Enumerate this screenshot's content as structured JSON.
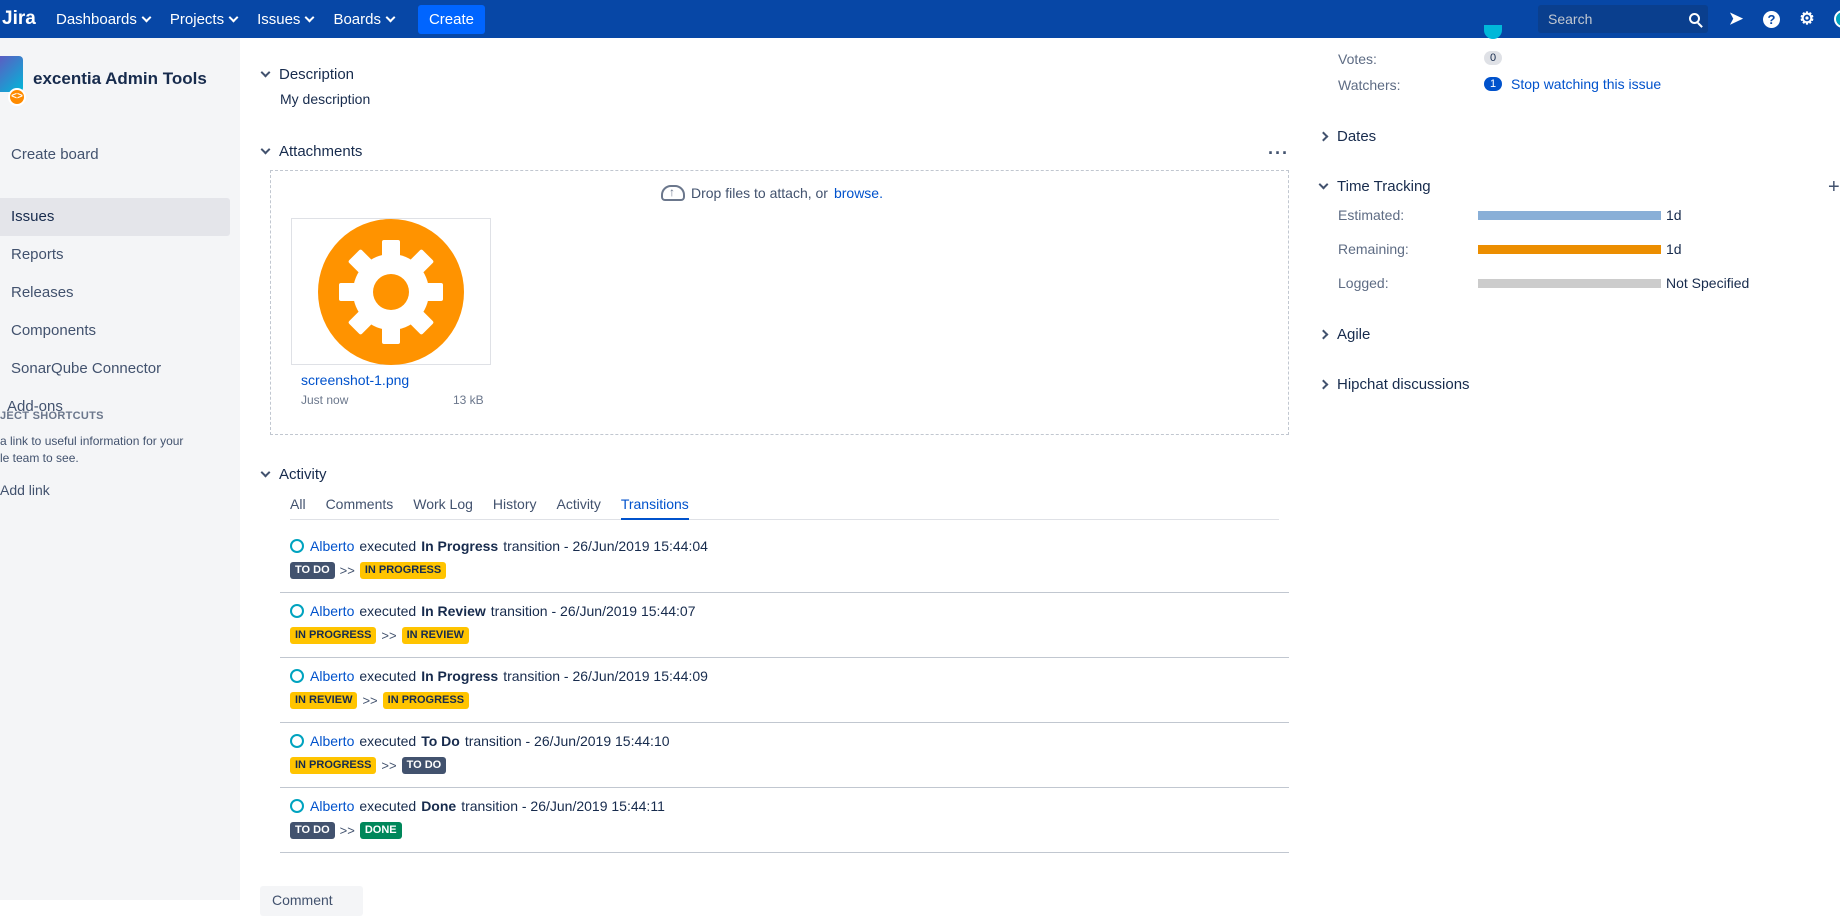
{
  "nav": {
    "logo": "Jira",
    "items": [
      "Dashboards",
      "Projects",
      "Issues",
      "Boards"
    ],
    "create_label": "Create",
    "search_placeholder": "Search"
  },
  "sidebar": {
    "project_name": "excentia Admin Tools",
    "items": [
      "Create board",
      "Issues",
      "Reports",
      "Releases",
      "Components",
      "SonarQube Connector",
      "Add-ons"
    ],
    "active_item": "Issues",
    "shortcuts_title": "JECT SHORTCUTS",
    "shortcuts_line1": "a link to useful information for your",
    "shortcuts_line2": "le team to see.",
    "add_link": "Add link"
  },
  "description": {
    "title": "Description",
    "text": "My description"
  },
  "attachments": {
    "title": "Attachments",
    "drop_text": "Drop files to attach, or",
    "browse": "browse.",
    "file": {
      "name": "screenshot-1.png",
      "time": "Just now",
      "size": "13 kB"
    }
  },
  "activity": {
    "title": "Activity",
    "tabs": [
      "All",
      "Comments",
      "Work Log",
      "History",
      "Activity",
      "Transitions"
    ],
    "active_tab": "Transitions",
    "transitions": [
      {
        "user": "Alberto",
        "verb": "executed",
        "name": "In Progress",
        "suffix": "transition - 26/Jun/2019 15:44:04",
        "from": "TO DO",
        "arrow": ">>",
        "to": "IN PROGRESS"
      },
      {
        "user": "Alberto",
        "verb": "executed",
        "name": "In Review",
        "suffix": "transition - 26/Jun/2019 15:44:07",
        "from": "IN PROGRESS",
        "arrow": ">>",
        "to": "IN REVIEW"
      },
      {
        "user": "Alberto",
        "verb": "executed",
        "name": "In Progress",
        "suffix": "transition - 26/Jun/2019 15:44:09",
        "from": "IN REVIEW",
        "arrow": ">>",
        "to": "IN PROGRESS"
      },
      {
        "user": "Alberto",
        "verb": "executed",
        "name": "To Do",
        "suffix": "transition - 26/Jun/2019 15:44:10",
        "from": "IN PROGRESS",
        "arrow": ">>",
        "to": "TO DO"
      },
      {
        "user": "Alberto",
        "verb": "executed",
        "name": "Done",
        "suffix": "transition - 26/Jun/2019 15:44:11",
        "from": "TO DO",
        "arrow": ">>",
        "to": "DONE"
      }
    ],
    "comment_button": "Comment"
  },
  "people": {
    "votes_label": "Votes:",
    "votes_count": "0",
    "watchers_label": "Watchers:",
    "watchers_count": "1",
    "watch_link": "Stop watching this issue"
  },
  "dates": {
    "title": "Dates"
  },
  "time_tracking": {
    "title": "Time Tracking",
    "estimated_label": "Estimated:",
    "estimated_value": "1d",
    "remaining_label": "Remaining:",
    "remaining_value": "1d",
    "logged_label": "Logged:",
    "logged_value": "Not Specified",
    "colors": {
      "estimated": "#89afd7",
      "remaining": "#ec8e00",
      "logged": "#cccccc"
    }
  },
  "agile": {
    "title": "Agile"
  },
  "hipchat": {
    "title": "Hipchat discussions"
  }
}
